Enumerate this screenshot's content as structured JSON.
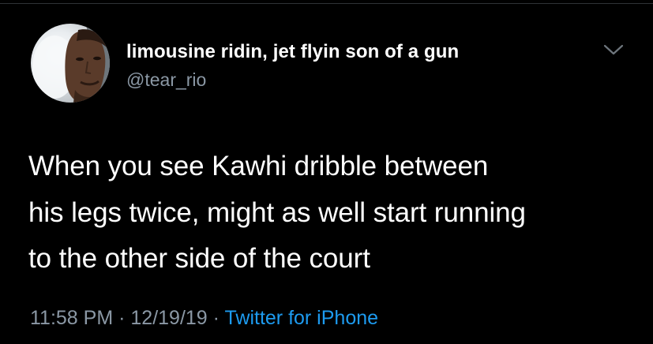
{
  "tweet": {
    "author": {
      "display_name": "limousine ridin, jet flyin son of a gun",
      "handle": "@tear_rio"
    },
    "text_lines": [
      "When you see Kawhi dribble between",
      "his legs twice, might as well start running",
      "to the other side of the court"
    ],
    "time": "11:58 PM",
    "separator": "·",
    "date": "12/19/19",
    "source": "Twitter for iPhone",
    "menu_icon": "chevron-down-icon"
  },
  "colors": {
    "background": "#000000",
    "text": "#ffffff",
    "secondary_text": "#8b98a5",
    "link": "#1d9bf0",
    "divider": "#2f3336"
  }
}
